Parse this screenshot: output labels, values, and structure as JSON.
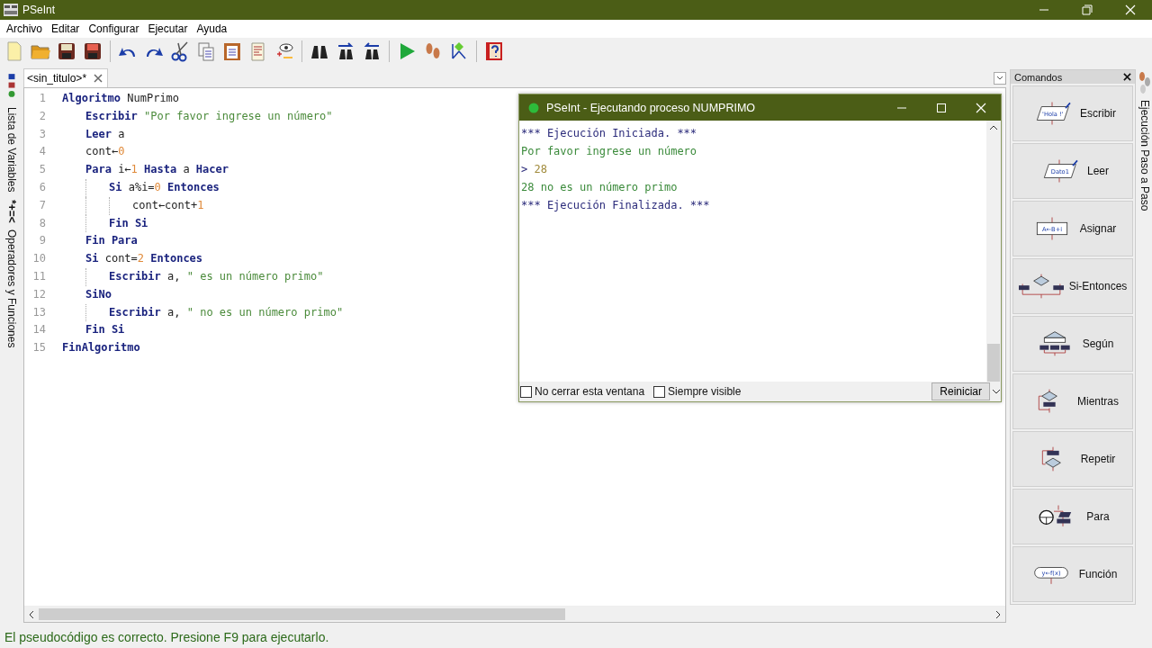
{
  "window": {
    "title": "PSeInt"
  },
  "menu": [
    "Archivo",
    "Editar",
    "Configurar",
    "Ejecutar",
    "Ayuda"
  ],
  "left_dock": [
    {
      "kind": "variables",
      "label": "Lista de Variables"
    },
    {
      "kind": "operators",
      "symbol": "*+=<",
      "label": "Operadores y Funciones"
    }
  ],
  "editor": {
    "tab": {
      "label": "<sin_titulo>*",
      "selected": true
    },
    "lines": [
      {
        "number": "1",
        "tokens": [
          {
            "kind": "keyword",
            "text": "Algoritmo"
          },
          {
            "kind": "plain",
            "text": " NumPrimo"
          }
        ],
        "children": [
          {
            "number": "2",
            "tokens": [
              {
                "kind": "keyword",
                "text": "Escribir"
              },
              {
                "kind": "string",
                "text": " \"Por favor ingrese un número\""
              }
            ]
          },
          {
            "number": "3",
            "tokens": [
              {
                "kind": "keyword",
                "text": "Leer"
              },
              {
                "kind": "plain",
                "text": " a"
              }
            ]
          },
          {
            "number": "4",
            "tokens": [
              {
                "kind": "plain",
                "text": "cont←"
              },
              {
                "kind": "number",
                "text": "0"
              }
            ]
          },
          {
            "number": "5",
            "tokens": [
              {
                "kind": "keyword",
                "text": "Para"
              },
              {
                "kind": "plain",
                "text": " i←"
              },
              {
                "kind": "number",
                "text": "1"
              },
              {
                "kind": "keyword",
                "text": " Hasta"
              },
              {
                "kind": "plain",
                "text": " a"
              },
              {
                "kind": "keyword",
                "text": " Hacer"
              }
            ],
            "children": [
              {
                "number": "6",
                "tokens": [
                  {
                    "kind": "keyword",
                    "text": "Si"
                  },
                  {
                    "kind": "plain",
                    "text": " a%i="
                  },
                  {
                    "kind": "number",
                    "text": "0"
                  },
                  {
                    "kind": "keyword",
                    "text": " Entonces"
                  }
                ],
                "children": [
                  {
                    "number": "7",
                    "tokens": [
                      {
                        "kind": "plain",
                        "text": "cont←cont+"
                      },
                      {
                        "kind": "number",
                        "text": "1"
                      }
                    ]
                  }
                ]
              },
              {
                "number": "8",
                "tokens": [
                  {
                    "kind": "keyword",
                    "text": "Fin Si"
                  }
                ]
              }
            ]
          },
          {
            "number": "9",
            "tokens": [
              {
                "kind": "keyword",
                "text": "Fin Para"
              }
            ]
          },
          {
            "number": "10",
            "tokens": [
              {
                "kind": "keyword",
                "text": "Si"
              },
              {
                "kind": "plain",
                "text": " cont="
              },
              {
                "kind": "number",
                "text": "2"
              },
              {
                "kind": "keyword",
                "text": " Entonces"
              }
            ],
            "children": [
              {
                "number": "11",
                "tokens": [
                  {
                    "kind": "keyword",
                    "text": "Escribir"
                  },
                  {
                    "kind": "plain",
                    "text": " a,"
                  },
                  {
                    "kind": "string",
                    "text": " \" es un número primo\""
                  }
                ]
              }
            ]
          },
          {
            "number": "12",
            "tokens": [
              {
                "kind": "keyword",
                "text": "SiNo"
              }
            ],
            "children": [
              {
                "number": "13",
                "tokens": [
                  {
                    "kind": "keyword",
                    "text": "Escribir"
                  },
                  {
                    "kind": "plain",
                    "text": " a,"
                  },
                  {
                    "kind": "string",
                    "text": " \" no es un número primo\""
                  }
                ]
              }
            ]
          },
          {
            "number": "14",
            "tokens": [
              {
                "kind": "keyword",
                "text": "Fin Si"
              }
            ]
          }
        ]
      },
      {
        "number": "15",
        "tokens": [
          {
            "kind": "keyword",
            "text": "FinAlgoritmo"
          }
        ]
      }
    ]
  },
  "console": {
    "title": "PSeInt - Ejecutando proceso NUMPRIMO",
    "lines": [
      {
        "kind": "system",
        "text": "*** Ejecución Iniciada. ***"
      },
      {
        "kind": "output",
        "text": "Por favor ingrese un número"
      },
      {
        "kind": "input",
        "prompt": ">",
        "text": "28"
      },
      {
        "kind": "output",
        "text": "28 no es un número primo"
      },
      {
        "kind": "system",
        "text": "*** Ejecución Finalizada. ***"
      }
    ],
    "options": [
      {
        "label": "No cerrar esta ventana",
        "checked": false
      },
      {
        "label": "Siempre visible",
        "checked": false
      }
    ],
    "button": "Reiniciar"
  },
  "commands": {
    "title": "Comandos",
    "items": [
      {
        "kind": "io",
        "icon_text": "'Hola !'",
        "label": "Escribir"
      },
      {
        "kind": "io",
        "icon_text": "Dato1",
        "label": "Leer"
      },
      {
        "kind": "assign",
        "icon_text": "A←B+i",
        "label": "Asignar"
      },
      {
        "kind": "if",
        "label": "Si-Entonces"
      },
      {
        "kind": "switch",
        "label": "Según"
      },
      {
        "kind": "while",
        "label": "Mientras"
      },
      {
        "kind": "repeat",
        "label": "Repetir"
      },
      {
        "kind": "for",
        "label": "Para"
      },
      {
        "kind": "function",
        "icon_text": "y←f(x)",
        "label": "Función"
      }
    ]
  },
  "right_dock": {
    "label": "Ejecución Paso a Paso"
  },
  "status_bar": "El pseudocódigo es correcto. Presione F9 para ejecutarlo."
}
